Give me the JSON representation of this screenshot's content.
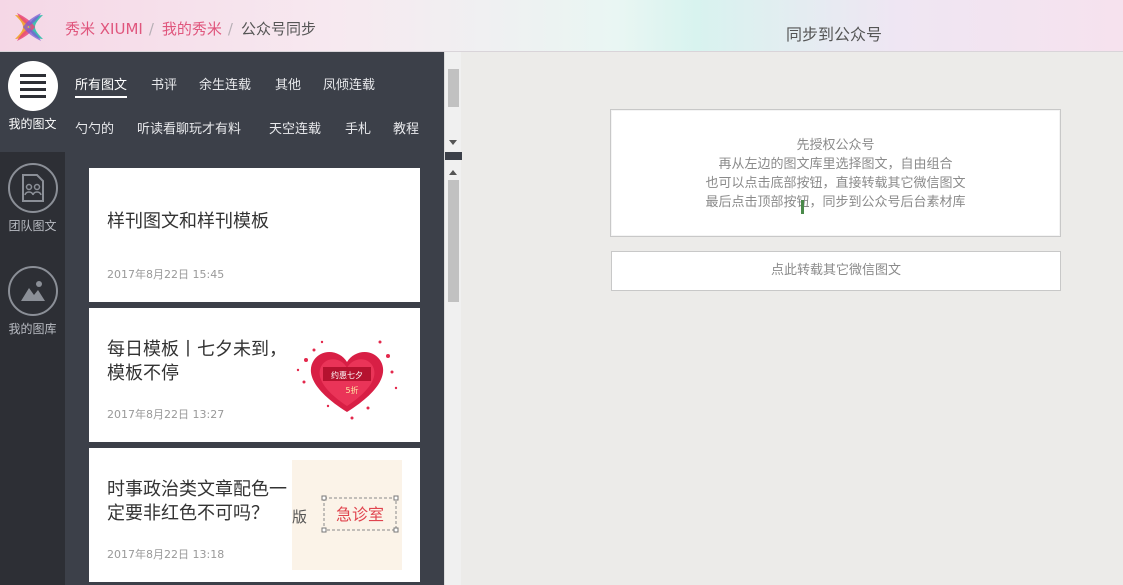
{
  "header": {
    "breadcrumb": [
      {
        "label": "秀米 XIUMI"
      },
      {
        "label": "我的秀米"
      }
    ],
    "separator": "/",
    "current": "公众号同步",
    "sync_title": "同步到公众号"
  },
  "rail": [
    {
      "label": "我的图文",
      "icon": "list-icon",
      "active": true
    },
    {
      "label": "团队图文",
      "icon": "team-doc-icon",
      "active": false
    },
    {
      "label": "我的图库",
      "icon": "gallery-icon",
      "active": false
    }
  ],
  "categories": {
    "row1": [
      "所有图文",
      "书评",
      "余生连载",
      "其他",
      "凤倾连载"
    ],
    "row2": [
      "勺勺的",
      "听读看聊玩才有料",
      "天空连载",
      "手札",
      "教程"
    ],
    "active": "所有图文"
  },
  "articles": [
    {
      "title": "样刊图文和样刊模板",
      "date": "2017年8月22日 15:45",
      "thumb": ""
    },
    {
      "title": "每日模板丨七夕未到，模板不停",
      "date": "2017年8月22日 13:27",
      "thumb": "heart-thumbnail",
      "thumb_text": [
        "约惠七夕",
        "5折"
      ]
    },
    {
      "title": "时事政治类文章配色一定要非红色不可吗？",
      "date": "2017年8月22日 13:18",
      "thumb": "stamp-thumbnail",
      "thumb_text": [
        "版",
        "急诊室"
      ]
    }
  ],
  "hint": {
    "lines": [
      "先授权公众号",
      "再从左边的图文库里选择图文，自由组合",
      "也可以点击底部按钮，直接转载其它微信图文",
      "最后点击顶部按钮，同步到公众号后台素材库"
    ]
  },
  "repost_button": "点此转载其它微信图文",
  "colors": {
    "accent": "#e0567d",
    "rail_bg": "#2d2f35",
    "panel_bg": "#3c4049",
    "content_bg": "#ecebe9"
  }
}
